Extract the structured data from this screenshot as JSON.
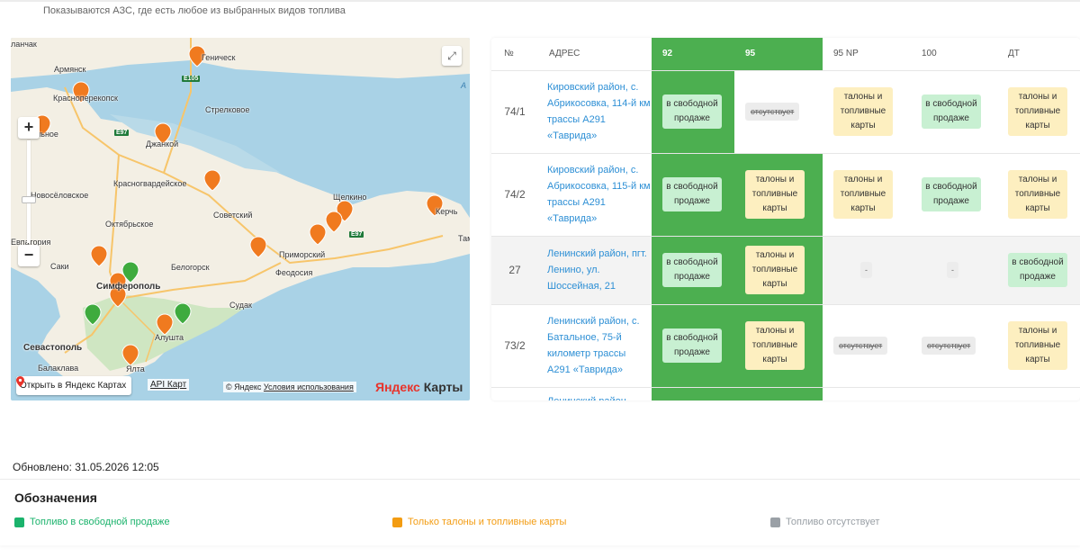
{
  "notice": "Показываются АЗС, где есть любое из выбранных видов топлива",
  "map": {
    "labels": {
      "lanchak": "ланчак",
      "armyansk": "Армянск",
      "genichesk": "Геническ",
      "krasnoperekopsk": "Красноперекопск",
      "razdolnoe": "льное",
      "strelkovoe": "Стрелковое",
      "dzhankoy": "Джанкой",
      "krasnogvardeyskoe": "Красногвардейское",
      "novoselovskoe": "Новосёловское",
      "shchelkino": "Щелкино",
      "sovetskiy": "Советский",
      "oktyabrskoe": "Октябрьское",
      "kerch": "Керчь",
      "evpatoria": "Евпатория",
      "primorskiy": "Приморский",
      "saki": "Саки",
      "belogorsk": "Белогорск",
      "feodosia": "Феодосия",
      "simferopol": "Симферополь",
      "sudak": "Судак",
      "alushta": "Алушта",
      "sevastopol": "Севастополь",
      "balaklava": "Балаклава",
      "yalta": "Ялта",
      "ta": "Там",
      "a": "А"
    },
    "roads": {
      "e105": "E105",
      "e97": "E97",
      "e97b": "E97"
    },
    "open_button": "Открыть в Яндекс Картах",
    "api_link": "API Карт",
    "copyright_prefix": "© Яндекс",
    "terms_link": "Условия использования",
    "logo_brand": "Яндекс",
    "logo_product": "Карты",
    "zoom_in": "+",
    "zoom_out": "−"
  },
  "table": {
    "headers": {
      "num": "№",
      "address": "АДРЕС",
      "f92": "92",
      "f95": "95",
      "f95np": "95 NP",
      "f100": "100",
      "dt": "ДТ"
    },
    "rows": [
      {
        "num": "74/1",
        "address": "Кировский район, с. Абрикосовка, 114-й км трассы А291 «Таврида»",
        "f92": "в свободной продаже",
        "f95": "отсутствует",
        "f95np": "талоны и топливные карты",
        "f100": "в свободной продаже",
        "dt": "талоны и топливные карты"
      },
      {
        "num": "74/2",
        "address": "Кировский район, с. Абрикосовка, 115-й км трассы А291 «Таврида»",
        "f92": "в свободной продаже",
        "f95": "талоны и топливные карты",
        "f95np": "талоны и топливные карты",
        "f100": "в свободной продаже",
        "dt": "талоны и топливные карты"
      },
      {
        "num": "27",
        "address": "Ленинский район, пгт. Ленино, ул. Шоссейная, 21",
        "f92": "в свободной продаже",
        "f95": "талоны и топливные карты",
        "f95np": "-",
        "f100": "-",
        "dt": "в свободной продаже"
      },
      {
        "num": "73/2",
        "address": "Ленинский район, с. Батальное, 75-й километр трассы А291 «Таврида»",
        "f92": "в свободной продаже",
        "f95": "талоны и топливные карты",
        "f95np": "отсутствует",
        "f100": "отсутствует",
        "dt": "талоны и топливные карты"
      },
      {
        "num": "",
        "address": "Ленинский район,",
        "f92": "",
        "f95": "",
        "f95np": "",
        "f100": "",
        "dt": ""
      }
    ]
  },
  "updated": "Обновлено: 31.05.2026 12:05",
  "legend": {
    "title": "Обозначения",
    "free": "Топливо в свободной продаже",
    "coupons": "Только талоны и топливные карты",
    "absent": "Топливо отсутствует"
  },
  "colors": {
    "selected_column": "#4caf50",
    "free": "#1bb36c",
    "coupons": "#f39c12",
    "absent": "#9aa0a6",
    "link": "#2d8fd5"
  }
}
